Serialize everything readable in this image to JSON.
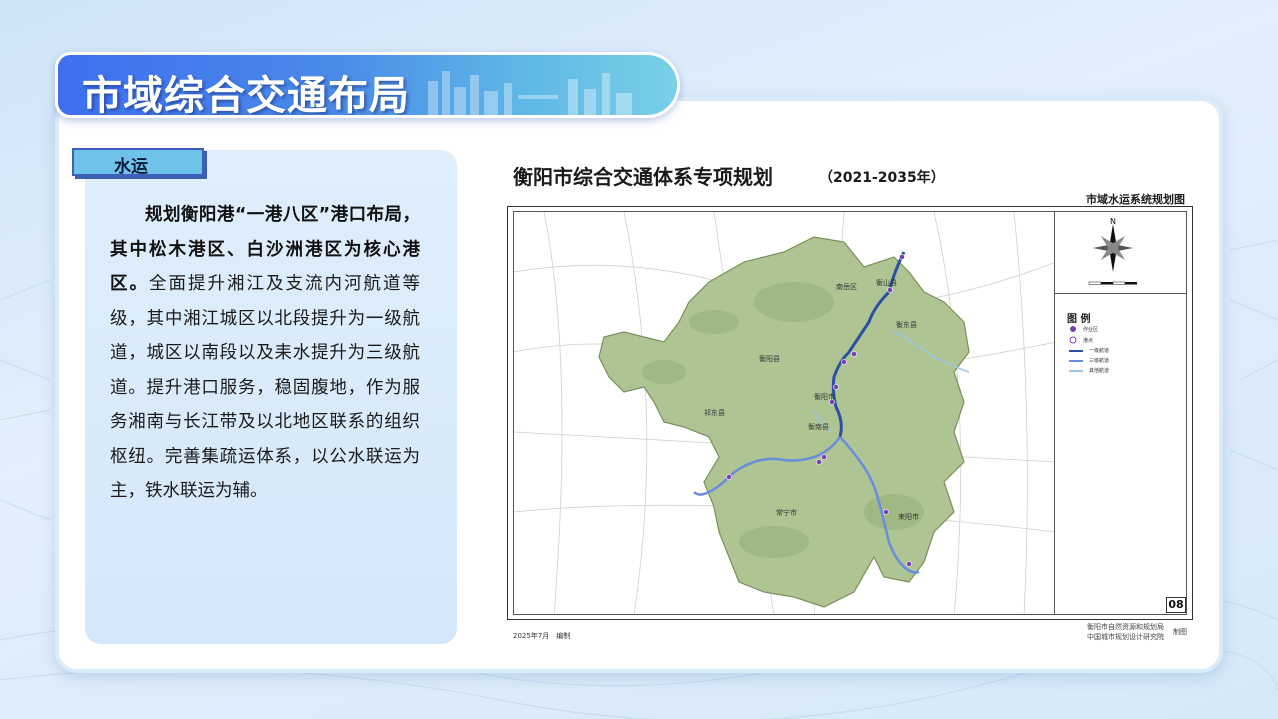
{
  "page": {
    "title": "市域综合交通布局"
  },
  "section": {
    "tag": "水运",
    "text_bold": "规划衡阳港“一港八区”港口布局，其中松木港区、白沙洲港区为核心港区。",
    "text_regular": "全面提升湘江及支流内河航道等级，其中湘江城区以北段提升为一级航道，城区以南段以及耒水提升为三级航道。提升港口服务，稳固腹地，作为服务湘南与长江带及以北地区联系的组织枢纽。完善集疏运体系，以公水联运为主，铁水联运为辅。"
  },
  "map": {
    "title": "衡阳市综合交通体系专项规划",
    "years": "（2021-2035年）",
    "subtitle": "市域水运系统规划图",
    "page_number": "08",
    "footer_date": "2025年7月　编制",
    "footer_org1": "衡阳市自然资源和规划局",
    "footer_org2": "中国城市规划设计研究院",
    "footer_made": "制图",
    "compass_label": "N",
    "legend": {
      "title": "图 例",
      "items": [
        "作业区",
        "港点",
        "一级航道",
        "三级航道",
        "其他航道"
      ]
    },
    "places": {
      "nanyue": "南岳区",
      "hengshan": "衡山县",
      "hengdong": "衡东县",
      "hengyang_county": "衡阳县",
      "hengyang_city": "衡阳市",
      "hengnan": "衡南县",
      "qidong": "祁东县",
      "changning": "常宁市",
      "leiyang": "耒阳市"
    },
    "colors": {
      "river_grade1": "#2a4fa3",
      "river_grade3": "#6a8ed8",
      "river_other": "#9cc6ea",
      "terrain": "#a9c08e",
      "port": "#7a3fb8"
    }
  }
}
